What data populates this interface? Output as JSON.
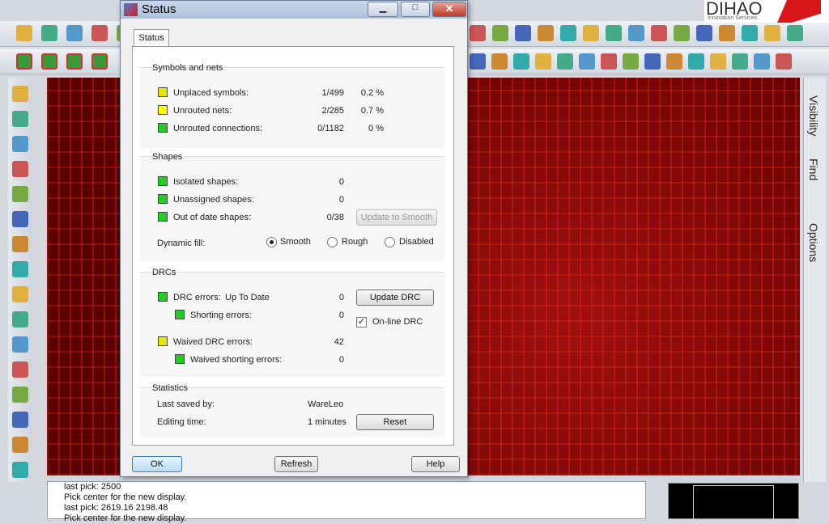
{
  "dialog": {
    "title": "Status",
    "tab": "Status",
    "symbols": {
      "heading": "Symbols and nets",
      "rows": [
        {
          "label": "Unplaced symbols:",
          "count": "1/499",
          "pct": "0.2 %",
          "color": "#e6e600"
        },
        {
          "label": "Unrouted nets:",
          "count": "2/285",
          "pct": "0.7 %",
          "color": "#ffff00"
        },
        {
          "label": "Unrouted connections:",
          "count": "0/1182",
          "pct": "0 %",
          "color": "#22cc22"
        }
      ]
    },
    "shapes": {
      "heading": "Shapes",
      "rows": [
        {
          "label": "Isolated shapes:",
          "count": "0",
          "color": "#22cc22"
        },
        {
          "label": "Unassigned shapes:",
          "count": "0",
          "color": "#22cc22"
        },
        {
          "label": "Out of date shapes:",
          "count": "0/38",
          "color": "#22cc22"
        }
      ],
      "update_smooth": "Update to Smooth",
      "dynamic_fill_label": "Dynamic fill:",
      "fill_options": [
        "Smooth",
        "Rough",
        "Disabled"
      ],
      "fill_selected": "Smooth"
    },
    "drcs": {
      "heading": "DRCs",
      "drc_errors": "DRC errors:",
      "drc_status": "Up To Date",
      "drc_count": "0",
      "shorting": "Shorting errors:",
      "shorting_count": "0",
      "waived": "Waived DRC errors:",
      "waived_count": "42",
      "waived_short": "Waived shorting errors:",
      "waived_short_count": "0",
      "update_drc": "Update DRC",
      "online_drc": "On-line DRC",
      "online_checked": true
    },
    "stats": {
      "heading": "Statistics",
      "saved_label": "Last saved by:",
      "saved_value": "WareLeo",
      "edit_label": "Editing time:",
      "edit_value": "1 minutes",
      "reset": "Reset"
    },
    "ok": "OK",
    "refresh": "Refresh",
    "help": "Help"
  },
  "logo": {
    "name": "DIHAO",
    "tagline": "Innovation Services"
  },
  "right_tabs": [
    "Visibility",
    "Find",
    "Options"
  ],
  "console": [
    "last pick:  2500",
    "Pick center for the new display.",
    "last pick:  2619.16 2198.48",
    "Pick center for the new display."
  ]
}
